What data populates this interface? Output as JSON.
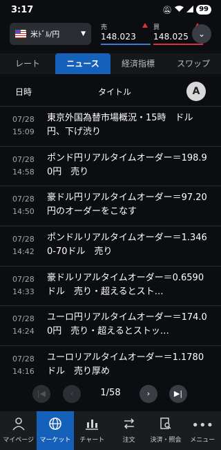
{
  "status": {
    "time": "3:17",
    "battery": "99"
  },
  "pair": {
    "name": "米ﾄﾞﾙ/円"
  },
  "bid": {
    "label": "売",
    "value": "148.023"
  },
  "ask": {
    "label": "買",
    "value": "148.025"
  },
  "tabs": [
    {
      "label": "レート"
    },
    {
      "label": "ニュース"
    },
    {
      "label": "経済指標"
    },
    {
      "label": "スワップ"
    }
  ],
  "table": {
    "col_date": "日時",
    "col_title": "タイトル",
    "font_btn": "A"
  },
  "news": [
    {
      "date": "07/28",
      "time": "15:09",
      "title": "東京外国為替市場概況・15時　ドル円、下げ渋り"
    },
    {
      "date": "07/28",
      "time": "14:58",
      "title": "ポンド円リアルタイムオーダー＝198.90円　売り"
    },
    {
      "date": "07/28",
      "time": "14:50",
      "title": "豪ドル円リアルタイムオーダー＝97.20円のオーダーをこなす"
    },
    {
      "date": "07/28",
      "time": "14:42",
      "title": "ポンドルリアルタイムオーダー＝1.3460-70ドル　売り"
    },
    {
      "date": "07/28",
      "time": "14:33",
      "title": "豪ドルリアルタイムオーダー＝0.6590ドル　売り・超えるとスト…"
    },
    {
      "date": "07/28",
      "time": "14:24",
      "title": "ユーロ円リアルタイムオーダー＝174.00円　売り・超えるとストッ…"
    },
    {
      "date": "07/28",
      "time": "14:16",
      "title": "ユーロリアルタイムオーダー＝1.1780ドル　売り厚め"
    }
  ],
  "pagination": {
    "current": "1/58"
  },
  "bottom_nav": [
    {
      "label": "マイページ",
      "icon": "person-icon"
    },
    {
      "label": "マーケット",
      "icon": "globe-icon"
    },
    {
      "label": "チャート",
      "icon": "chart-icon"
    },
    {
      "label": "注文",
      "icon": "order-icon"
    },
    {
      "label": "決済・照会",
      "icon": "document-search-icon"
    },
    {
      "label": "メニュー",
      "icon": "more-icon"
    }
  ],
  "colors": {
    "accent": "#1560b8",
    "sell": "#3a7bd5",
    "buy": "#e0303a"
  }
}
